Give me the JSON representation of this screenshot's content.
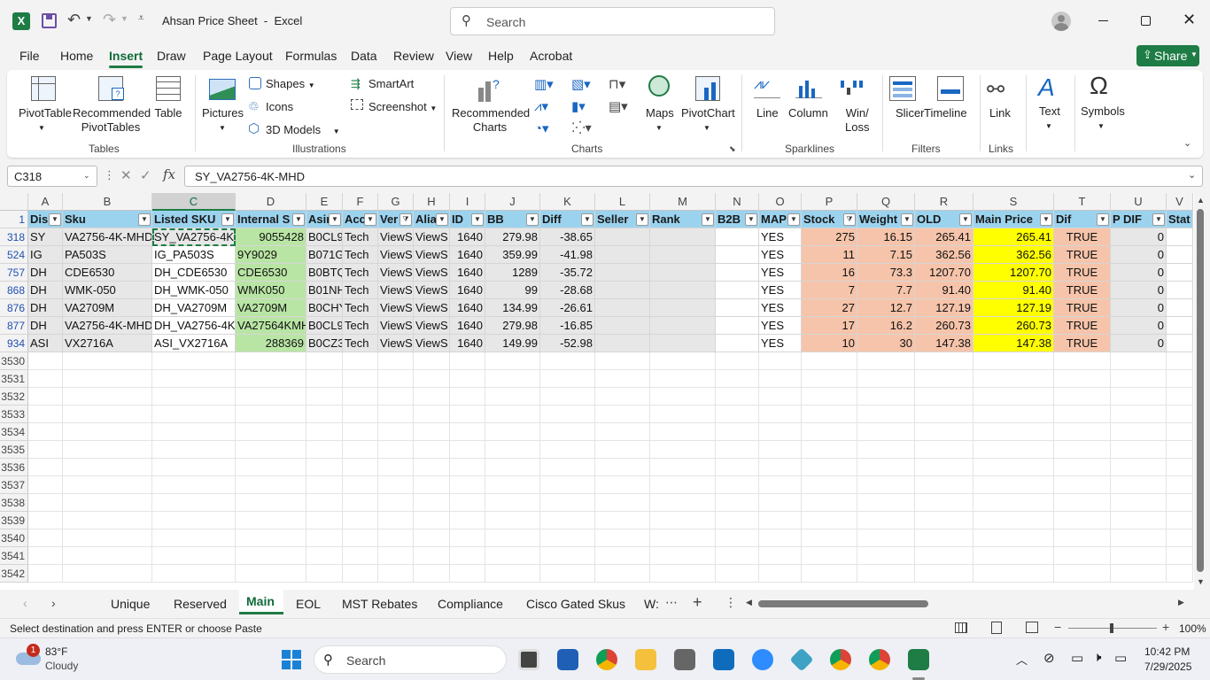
{
  "titlebar": {
    "doc_title": "Ahsan Price Sheet  -  Excel",
    "search_placeholder": "Search",
    "share_label": "Share"
  },
  "menu_tabs": [
    "File",
    "Home",
    "Insert",
    "Draw",
    "Page Layout",
    "Formulas",
    "Data",
    "Review",
    "View",
    "Help",
    "Acrobat"
  ],
  "active_tab": "Insert",
  "ribbon": {
    "pivot_table": "PivotTable",
    "recommended_pivot": "Recommended\nPivotTables",
    "table": "Table",
    "pictures": "Pictures",
    "shapes": "Shapes",
    "icons": "Icons",
    "models_3d": "3D Models",
    "smartart": "SmartArt",
    "screenshot": "Screenshot",
    "recommended_charts": "Recommended\nCharts",
    "maps": "Maps",
    "pivot_chart": "PivotChart",
    "line": "Line",
    "column": "Column",
    "win_loss": "Win/\nLoss",
    "slicer": "Slicer",
    "timeline": "Timeline",
    "link": "Link",
    "text": "Text",
    "symbols": "Symbols",
    "groups": {
      "tables": "Tables",
      "illustrations": "Illustrations",
      "charts": "Charts",
      "sparklines": "Sparklines",
      "filters": "Filters",
      "links": "Links"
    }
  },
  "formula_bar": {
    "name_box": "C318",
    "fx": "fx",
    "formula": "SY_VA2756-4K-MHD"
  },
  "columns": [
    "A",
    "B",
    "C",
    "D",
    "E",
    "F",
    "G",
    "H",
    "I",
    "J",
    "K",
    "L",
    "M",
    "N",
    "O",
    "P",
    "Q",
    "R",
    "S",
    "T",
    "U",
    "V"
  ],
  "header_row_num": "1",
  "headers": [
    "Dis",
    "Sku",
    "Listed SKU",
    "Internal S",
    "Asin",
    "Acc",
    "Ver",
    "Alia",
    "ID",
    "BB",
    "Diff",
    "Seller",
    "Rank",
    "B2B",
    "MAP",
    "Stock",
    "Weight",
    "OLD",
    "Main Price",
    "Dif",
    "P DIF",
    "Stat"
  ],
  "rows": [
    {
      "num": "318",
      "cells": [
        "SY",
        "VA2756-4K-MHD",
        "SY_VA2756-4K-",
        "9055428",
        "B0CL9F",
        "Tech",
        "ViewS",
        "ViewS",
        "1640",
        "279.98",
        "-38.65",
        "",
        "",
        "",
        "YES",
        "275",
        "16.15",
        "265.41",
        "265.41",
        "TRUE",
        "0",
        ""
      ]
    },
    {
      "num": "524",
      "cells": [
        "IG",
        "PA503S",
        "IG_PA503S",
        "9Y9029",
        "B071G5",
        "Tech",
        "ViewS",
        "ViewS",
        "1640",
        "359.99",
        "-41.98",
        "",
        "",
        "",
        "YES",
        "11",
        "7.15",
        "362.56",
        "362.56",
        "TRUE",
        "0",
        ""
      ]
    },
    {
      "num": "757",
      "cells": [
        "DH",
        "CDE6530",
        "DH_CDE6530",
        "CDE6530",
        "B0BTQ",
        "Tech",
        "ViewS",
        "ViewS",
        "1640",
        "1289",
        "-35.72",
        "",
        "",
        "",
        "YES",
        "16",
        "73.3",
        "1207.70",
        "1207.70",
        "TRUE",
        "0",
        ""
      ]
    },
    {
      "num": "868",
      "cells": [
        "DH",
        "WMK-050",
        "DH_WMK-050",
        "WMK050",
        "B01NH",
        "Tech",
        "ViewS",
        "ViewS",
        "1640",
        "99",
        "-28.68",
        "",
        "",
        "",
        "YES",
        "7",
        "7.7",
        "91.40",
        "91.40",
        "TRUE",
        "0",
        ""
      ]
    },
    {
      "num": "876",
      "cells": [
        "DH",
        "VA2709M",
        "DH_VA2709M",
        "VA2709M",
        "B0CHY",
        "Tech",
        "ViewS",
        "ViewS",
        "1640",
        "134.99",
        "-26.61",
        "",
        "",
        "",
        "YES",
        "27",
        "12.7",
        "127.19",
        "127.19",
        "TRUE",
        "0",
        ""
      ]
    },
    {
      "num": "877",
      "cells": [
        "DH",
        "VA2756-4K-MHD",
        "DH_VA2756-4K-",
        "VA27564KMH",
        "B0CL9F",
        "Tech",
        "ViewS",
        "ViewS",
        "1640",
        "279.98",
        "-16.85",
        "",
        "",
        "",
        "YES",
        "17",
        "16.2",
        "260.73",
        "260.73",
        "TRUE",
        "0",
        ""
      ]
    },
    {
      "num": "934",
      "cells": [
        "ASI",
        "VX2716A",
        "ASI_VX2716A",
        "288369",
        "B0CZ3K",
        "Tech",
        "ViewS",
        "ViewS",
        "1640",
        "149.99",
        "-52.98",
        "",
        "",
        "",
        "YES",
        "10",
        "30",
        "147.38",
        "147.38",
        "TRUE",
        "0",
        ""
      ]
    }
  ],
  "empty_rows": [
    "3530",
    "3531",
    "3532",
    "3533",
    "3534",
    "3535",
    "3536",
    "3537",
    "3538",
    "3539",
    "3540",
    "3541",
    "3542"
  ],
  "sheet_tabs": [
    "Unique",
    "Reserved",
    "Main",
    "EOL",
    "MST Rebates",
    "Compliance",
    "Cisco Gated Skus",
    "W:"
  ],
  "active_sheet": "Main",
  "status": {
    "message": "Select destination and press ENTER or choose Paste",
    "zoom": "100%"
  },
  "taskbar": {
    "weather_temp": "83°F",
    "weather_desc": "Cloudy",
    "weather_badge": "1",
    "search_placeholder": "Search",
    "time": "10:42 PM",
    "date": "7/29/2025"
  },
  "colors": {
    "accent": "#217346",
    "header_fill": "#9bd3ef",
    "green_fill": "#b9e5a4",
    "salmon_fill": "#f6c4aa",
    "yellow_fill": "#ffff00",
    "gray_fill": "#e7e7e7"
  }
}
